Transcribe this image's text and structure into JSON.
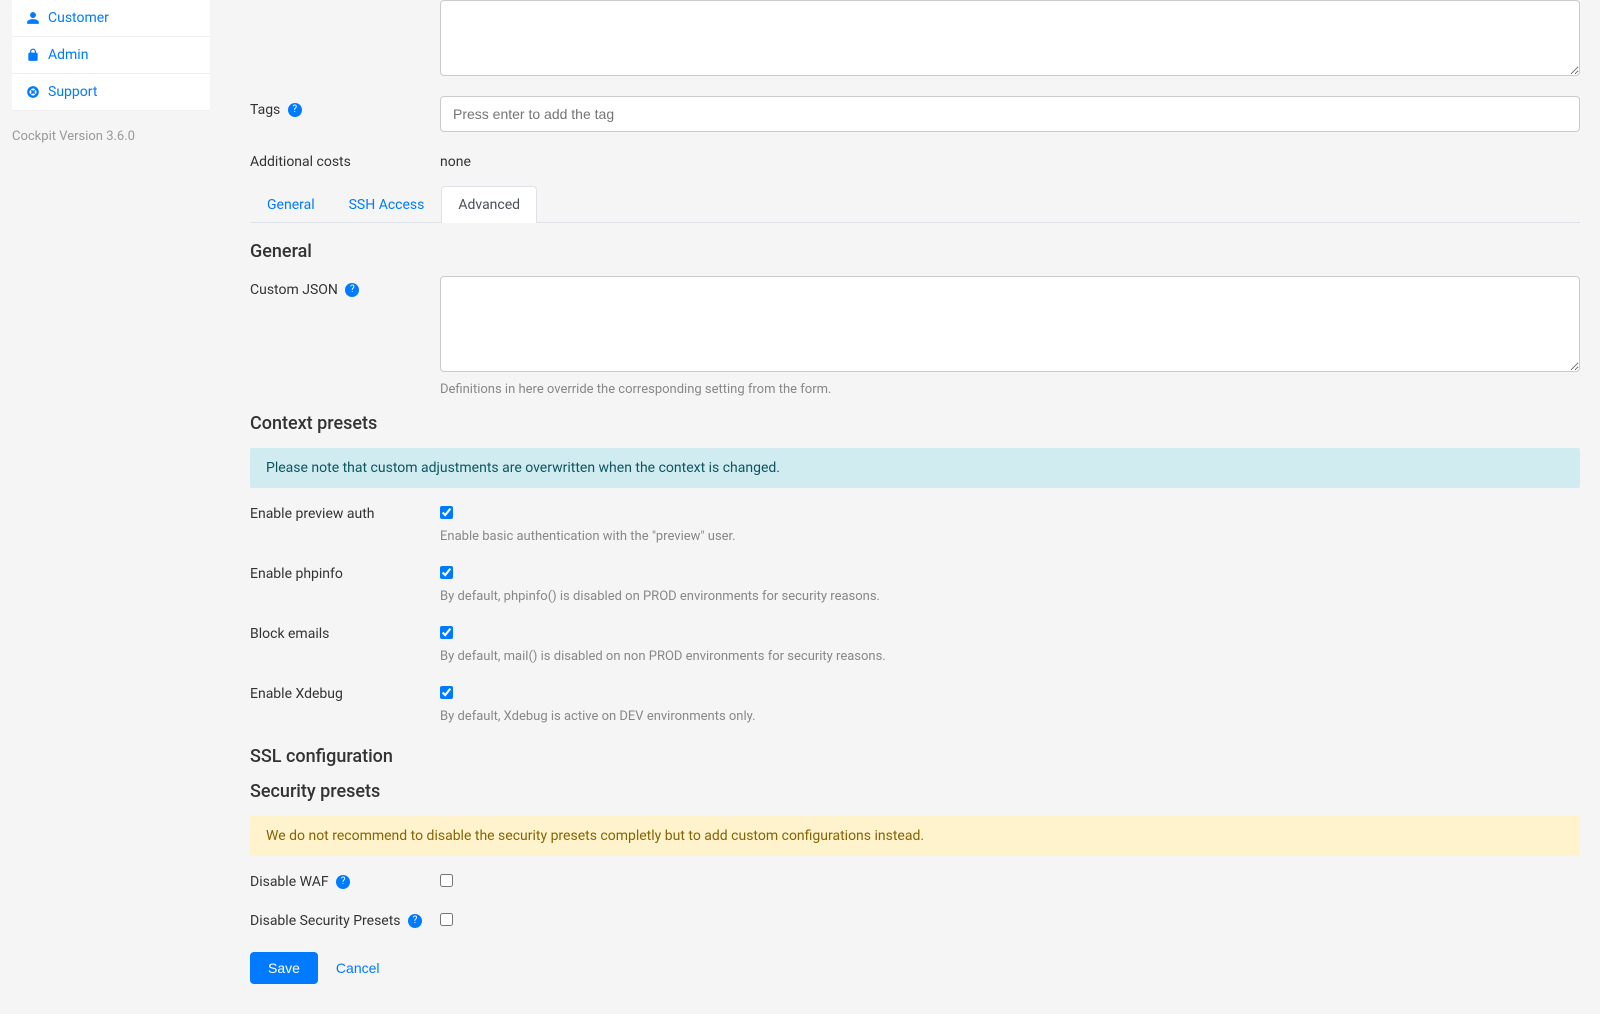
{
  "sidebar": {
    "items": [
      {
        "label": "Customer"
      },
      {
        "label": "Admin"
      },
      {
        "label": "Support"
      }
    ],
    "version": "Cockpit Version 3.6.0"
  },
  "form": {
    "tags_label": "Tags",
    "tags_placeholder": "Press enter to add the tag",
    "additional_costs_label": "Additional costs",
    "additional_costs_value": "none"
  },
  "tabs": {
    "general": "General",
    "ssh": "SSH Access",
    "advanced": "Advanced"
  },
  "sections": {
    "general_heading": "General",
    "custom_json_label": "Custom JSON",
    "custom_json_hint": "Definitions in here override the corresponding setting from the form.",
    "context_presets_heading": "Context presets",
    "context_presets_alert": "Please note that custom adjustments are overwritten when the context is changed.",
    "checkboxes": [
      {
        "label": "Enable preview auth",
        "checked": true,
        "hint": "Enable basic authentication with the \"preview\" user."
      },
      {
        "label": "Enable phpinfo",
        "checked": true,
        "hint": "By default, phpinfo() is disabled on PROD environments for security reasons."
      },
      {
        "label": "Block emails",
        "checked": true,
        "hint": "By default, mail() is disabled on non PROD environments for security reasons."
      },
      {
        "label": "Enable Xdebug",
        "checked": true,
        "hint": "By default, Xdebug is active on DEV environments only."
      }
    ],
    "ssl_heading": "SSL configuration",
    "security_presets_heading": "Security presets",
    "security_presets_alert": "We do not recommend to disable the security presets completly but to add custom configurations instead.",
    "security_checkboxes": [
      {
        "label": "Disable WAF",
        "checked": false,
        "help": true
      },
      {
        "label": "Disable Security Presets",
        "checked": false,
        "help": true
      }
    ]
  },
  "buttons": {
    "save": "Save",
    "cancel": "Cancel"
  }
}
